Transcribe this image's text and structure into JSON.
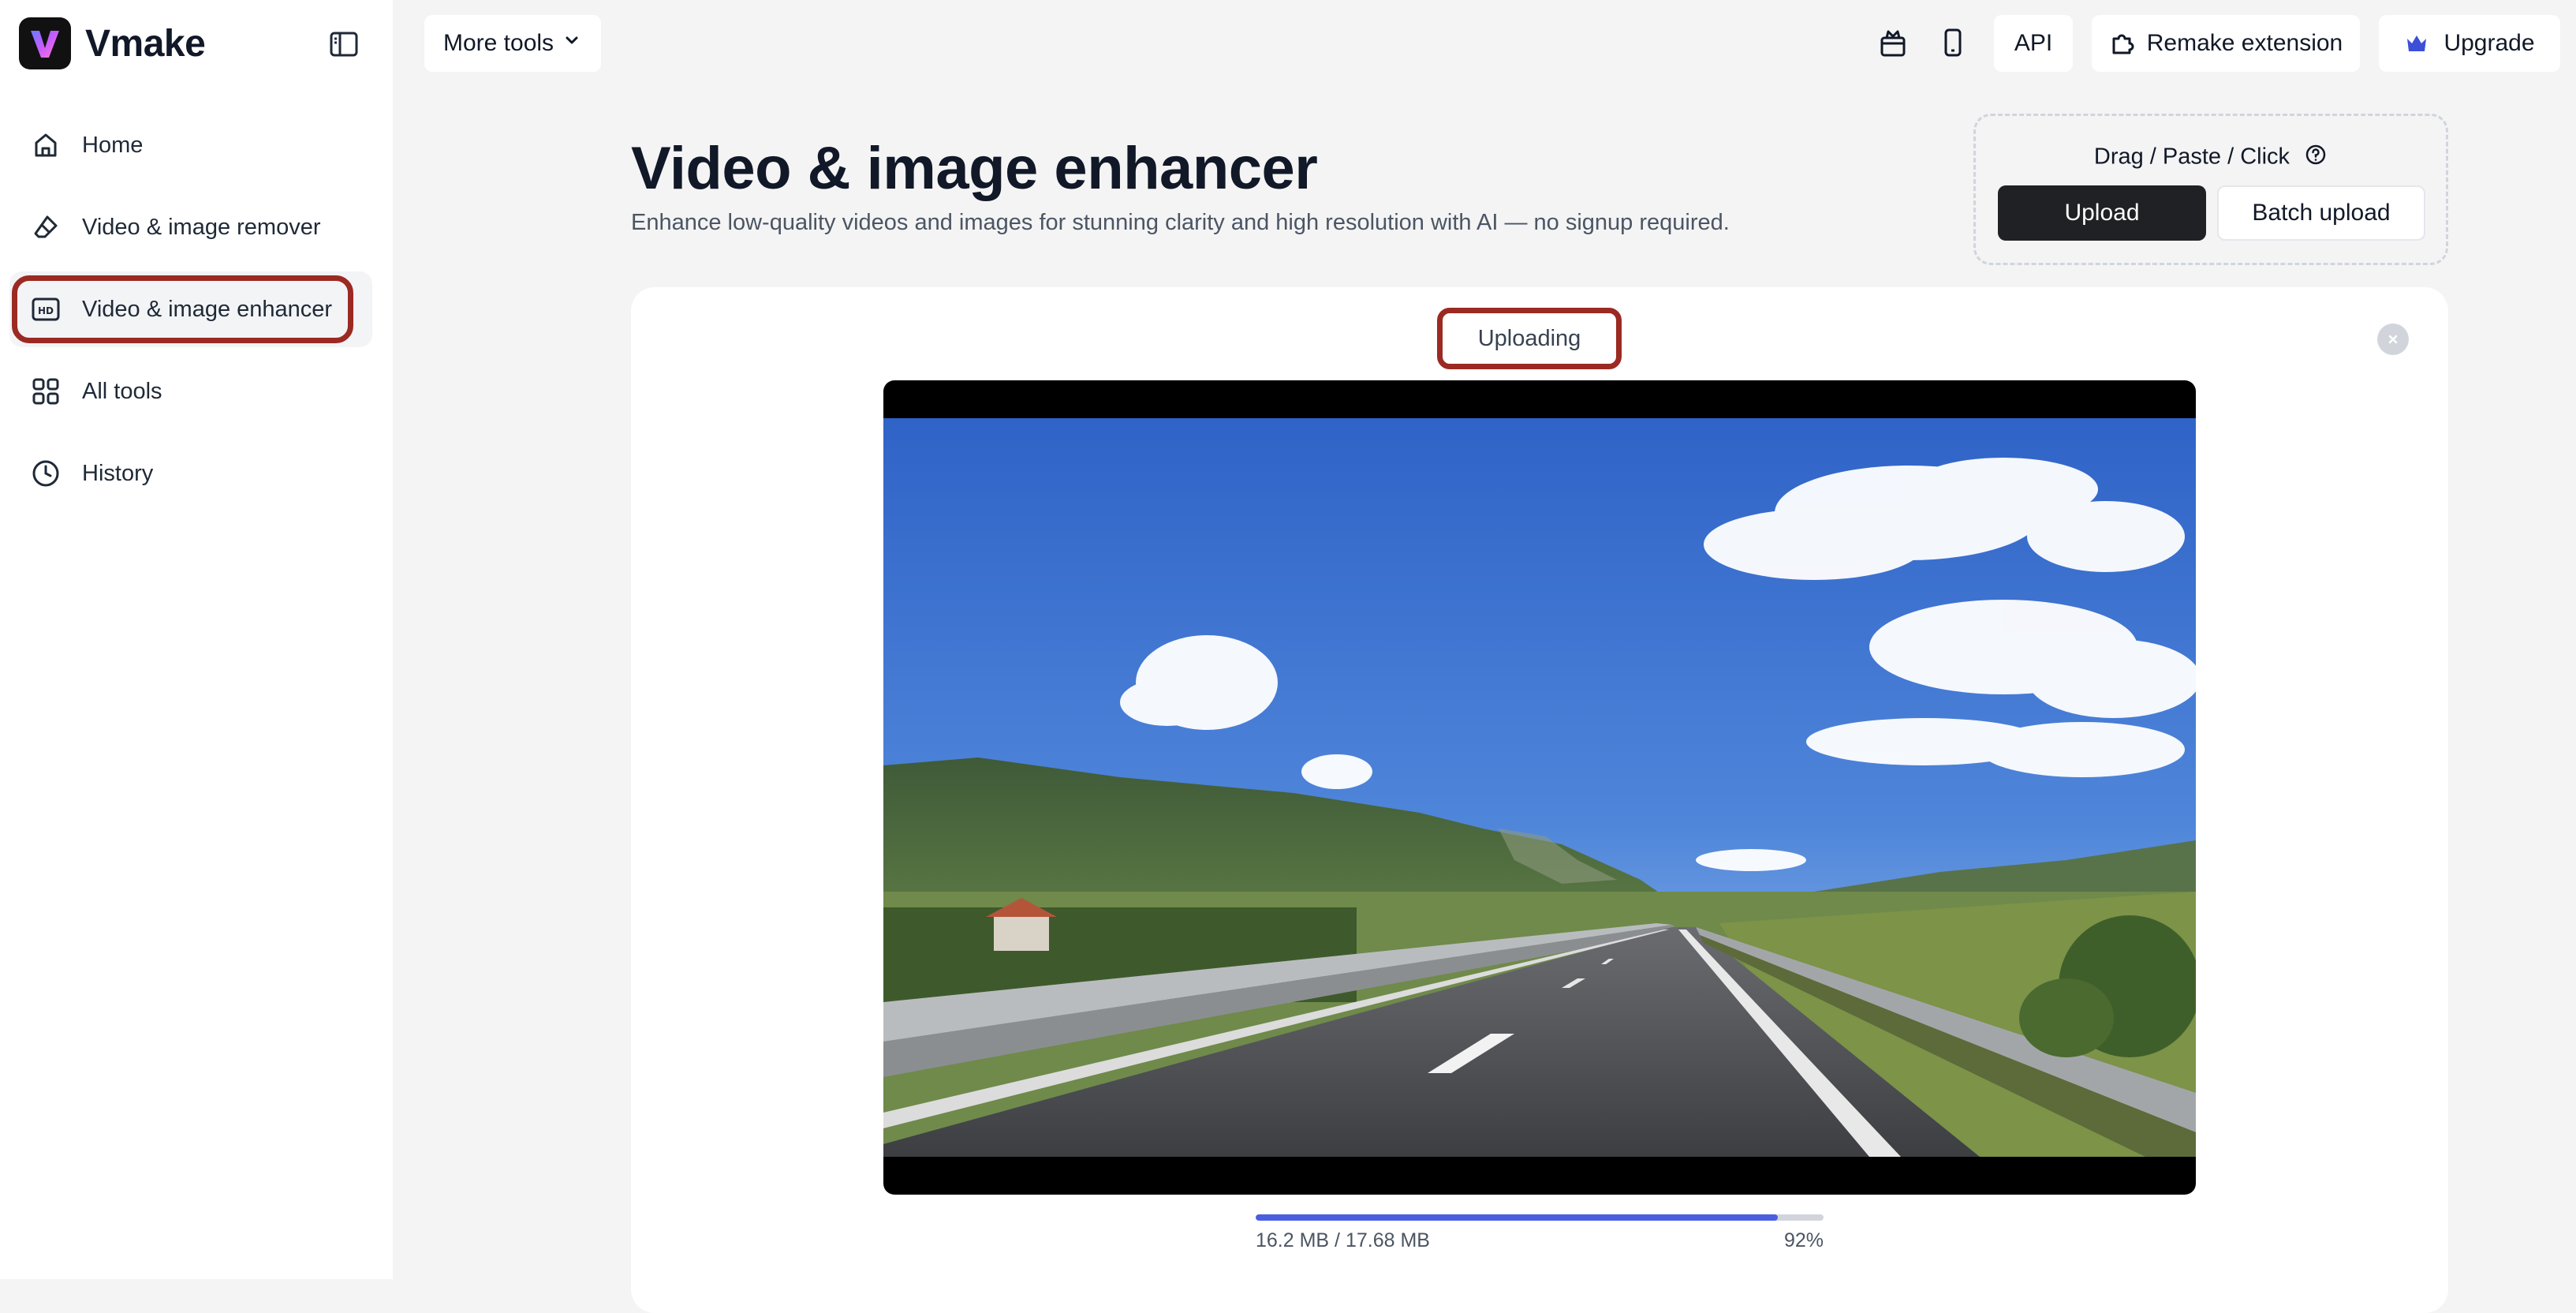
{
  "app": {
    "name": "Vmake"
  },
  "sidebar": {
    "items": [
      {
        "label": "Home",
        "icon": "home-icon"
      },
      {
        "label": "Video & image remover",
        "icon": "eraser-icon"
      },
      {
        "label": "Video & image enhancer",
        "icon": "hd-icon",
        "active": true
      },
      {
        "label": "All tools",
        "icon": "grid-icon"
      },
      {
        "label": "History",
        "icon": "clock-icon"
      }
    ]
  },
  "topbar": {
    "more_tools": "More tools",
    "api": "API",
    "remake_extension": "Remake extension",
    "upgrade": "Upgrade"
  },
  "page": {
    "title": "Video & image enhancer",
    "subtitle": "Enhance low-quality videos and images for stunning clarity and high resolution with AI — no signup required."
  },
  "upload": {
    "hint": "Drag / Paste / Click",
    "upload_label": "Upload",
    "batch_label": "Batch upload"
  },
  "status": {
    "label": "Uploading",
    "size_text": "16.2 MB / 17.68 MB",
    "percent_text": "92%",
    "progress": 0.92
  },
  "colors": {
    "accent": "#4a5fe0",
    "highlight": "#9b2a22",
    "primary_button": "#1f2124"
  }
}
